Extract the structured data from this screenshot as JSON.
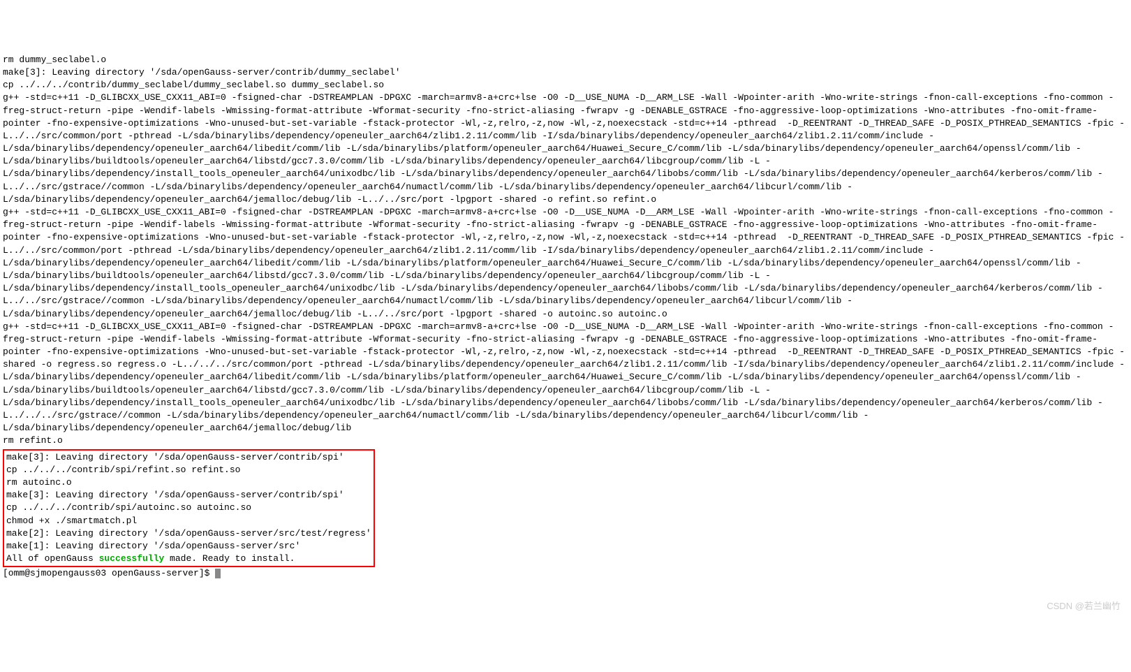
{
  "terminal": {
    "block1": "rm dummy_seclabel.o\nmake[3]: Leaving directory '/sda/openGauss-server/contrib/dummy_seclabel'\ncp ../../../contrib/dummy_seclabel/dummy_seclabel.so dummy_seclabel.so\ng++ -std=c++11 -D_GLIBCXX_USE_CXX11_ABI=0 -fsigned-char -DSTREAMPLAN -DPGXC -march=armv8-a+crc+lse -O0 -D__USE_NUMA -D__ARM_LSE -Wall -Wpointer-arith -Wno-write-strings -fnon-call-exceptions -fno-common -freg-struct-return -pipe -Wendif-labels -Wmissing-format-attribute -Wformat-security -fno-strict-aliasing -fwrapv -g -DENABLE_GSTRACE -fno-aggressive-loop-optimizations -Wno-attributes -fno-omit-frame-pointer -fno-expensive-optimizations -Wno-unused-but-set-variable -fstack-protector -Wl,-z,relro,-z,now -Wl,-z,noexecstack -std=c++14 -pthread  -D_REENTRANT -D_THREAD_SAFE -D_POSIX_PTHREAD_SEMANTICS -fpic -L../../src/common/port -pthread -L/sda/binarylibs/dependency/openeuler_aarch64/zlib1.2.11/comm/lib -I/sda/binarylibs/dependency/openeuler_aarch64/zlib1.2.11/comm/include -L/sda/binarylibs/dependency/openeuler_aarch64/libedit/comm/lib -L/sda/binarylibs/platform/openeuler_aarch64/Huawei_Secure_C/comm/lib -L/sda/binarylibs/dependency/openeuler_aarch64/openssl/comm/lib -L/sda/binarylibs/buildtools/openeuler_aarch64/libstd/gcc7.3.0/comm/lib -L/sda/binarylibs/dependency/openeuler_aarch64/libcgroup/comm/lib -L -L/sda/binarylibs/dependency/install_tools_openeuler_aarch64/unixodbc/lib -L/sda/binarylibs/dependency/openeuler_aarch64/libobs/comm/lib -L/sda/binarylibs/dependency/openeuler_aarch64/kerberos/comm/lib -L../../src/gstrace//common -L/sda/binarylibs/dependency/openeuler_aarch64/numactl/comm/lib -L/sda/binarylibs/dependency/openeuler_aarch64/libcurl/comm/lib -L/sda/binarylibs/dependency/openeuler_aarch64/jemalloc/debug/lib -L../../src/port -lpgport -shared -o refint.so refint.o\ng++ -std=c++11 -D_GLIBCXX_USE_CXX11_ABI=0 -fsigned-char -DSTREAMPLAN -DPGXC -march=armv8-a+crc+lse -O0 -D__USE_NUMA -D__ARM_LSE -Wall -Wpointer-arith -Wno-write-strings -fnon-call-exceptions -fno-common -freg-struct-return -pipe -Wendif-labels -Wmissing-format-attribute -Wformat-security -fno-strict-aliasing -fwrapv -g -DENABLE_GSTRACE -fno-aggressive-loop-optimizations -Wno-attributes -fno-omit-frame-pointer -fno-expensive-optimizations -Wno-unused-but-set-variable -fstack-protector -Wl,-z,relro,-z,now -Wl,-z,noexecstack -std=c++14 -pthread  -D_REENTRANT -D_THREAD_SAFE -D_POSIX_PTHREAD_SEMANTICS -fpic -L../../src/common/port -pthread -L/sda/binarylibs/dependency/openeuler_aarch64/zlib1.2.11/comm/lib -I/sda/binarylibs/dependency/openeuler_aarch64/zlib1.2.11/comm/include -L/sda/binarylibs/dependency/openeuler_aarch64/libedit/comm/lib -L/sda/binarylibs/platform/openeuler_aarch64/Huawei_Secure_C/comm/lib -L/sda/binarylibs/dependency/openeuler_aarch64/openssl/comm/lib -L/sda/binarylibs/buildtools/openeuler_aarch64/libstd/gcc7.3.0/comm/lib -L/sda/binarylibs/dependency/openeuler_aarch64/libcgroup/comm/lib -L -L/sda/binarylibs/dependency/install_tools_openeuler_aarch64/unixodbc/lib -L/sda/binarylibs/dependency/openeuler_aarch64/libobs/comm/lib -L/sda/binarylibs/dependency/openeuler_aarch64/kerberos/comm/lib -L../../src/gstrace//common -L/sda/binarylibs/dependency/openeuler_aarch64/numactl/comm/lib -L/sda/binarylibs/dependency/openeuler_aarch64/libcurl/comm/lib -L/sda/binarylibs/dependency/openeuler_aarch64/jemalloc/debug/lib -L../../src/port -lpgport -shared -o autoinc.so autoinc.o\ng++ -std=c++11 -D_GLIBCXX_USE_CXX11_ABI=0 -fsigned-char -DSTREAMPLAN -DPGXC -march=armv8-a+crc+lse -O0 -D__USE_NUMA -D__ARM_LSE -Wall -Wpointer-arith -Wno-write-strings -fnon-call-exceptions -fno-common -freg-struct-return -pipe -Wendif-labels -Wmissing-format-attribute -Wformat-security -fno-strict-aliasing -fwrapv -g -DENABLE_GSTRACE -fno-aggressive-loop-optimizations -Wno-attributes -fno-omit-frame-pointer -fno-expensive-optimizations -Wno-unused-but-set-variable -fstack-protector -Wl,-z,relro,-z,now -Wl,-z,noexecstack -std=c++14 -pthread  -D_REENTRANT -D_THREAD_SAFE -D_POSIX_PTHREAD_SEMANTICS -fpic -shared -o regress.so regress.o -L../../../src/common/port -pthread -L/sda/binarylibs/dependency/openeuler_aarch64/zlib1.2.11/comm/lib -I/sda/binarylibs/dependency/openeuler_aarch64/zlib1.2.11/comm/include -L/sda/binarylibs/dependency/openeuler_aarch64/libedit/comm/lib -L/sda/binarylibs/platform/openeuler_aarch64/Huawei_Secure_C/comm/lib -L/sda/binarylibs/dependency/openeuler_aarch64/openssl/comm/lib -L/sda/binarylibs/buildtools/openeuler_aarch64/libstd/gcc7.3.0/comm/lib -L/sda/binarylibs/dependency/openeuler_aarch64/libcgroup/comm/lib -L -L/sda/binarylibs/dependency/install_tools_openeuler_aarch64/unixodbc/lib -L/sda/binarylibs/dependency/openeuler_aarch64/libobs/comm/lib -L/sda/binarylibs/dependency/openeuler_aarch64/kerberos/comm/lib -L../../../src/gstrace//common -L/sda/binarylibs/dependency/openeuler_aarch64/numactl/comm/lib -L/sda/binarylibs/dependency/openeuler_aarch64/libcurl/comm/lib -L/sda/binarylibs/dependency/openeuler_aarch64/jemalloc/debug/lib\nrm refint.o",
    "highlighted": {
      "line1": "make[3]: Leaving directory '/sda/openGauss-server/contrib/spi'",
      "line2": "cp ../../../contrib/spi/refint.so refint.so",
      "line3": "rm autoinc.o",
      "line4": "make[3]: Leaving directory '/sda/openGauss-server/contrib/spi'",
      "line5": "cp ../../../contrib/spi/autoinc.so autoinc.so",
      "line6": "chmod +x ./smartmatch.pl",
      "line7": "make[2]: Leaving directory '/sda/openGauss-server/src/test/regress'",
      "line8": "make[1]: Leaving directory '/sda/openGauss-server/src'",
      "line9_part1": "All of openGauss ",
      "line9_success": "successfully",
      "line9_part2": " made. Ready to install."
    },
    "prompt": "[omm@sjmopengauss03 openGauss-server]$ "
  },
  "watermark": "CSDN @若兰幽竹"
}
